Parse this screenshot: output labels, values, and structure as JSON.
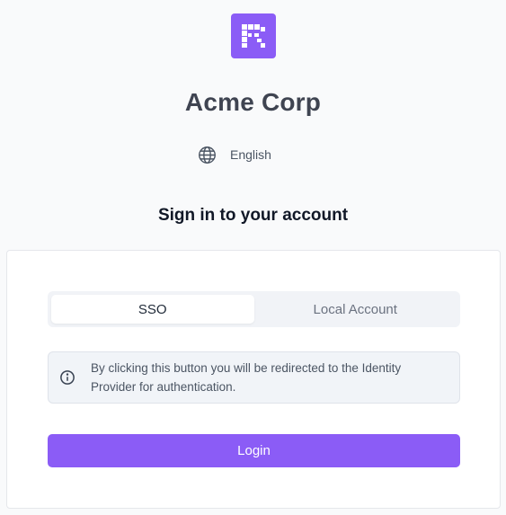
{
  "brand": {
    "name": "Acme Corp",
    "logo_icon": "pixel-r-logo-icon",
    "accent_color": "#8b5cf6"
  },
  "language": {
    "icon": "globe-icon",
    "label": "English"
  },
  "signin": {
    "title": "Sign in to your account"
  },
  "tabs": [
    {
      "label": "SSO",
      "active": true
    },
    {
      "label": "Local Account",
      "active": false
    }
  ],
  "notice": {
    "icon": "info-icon",
    "text": "By clicking this button you will be redirected to the Identity Provider for authentication."
  },
  "login_button": {
    "label": "Login"
  }
}
